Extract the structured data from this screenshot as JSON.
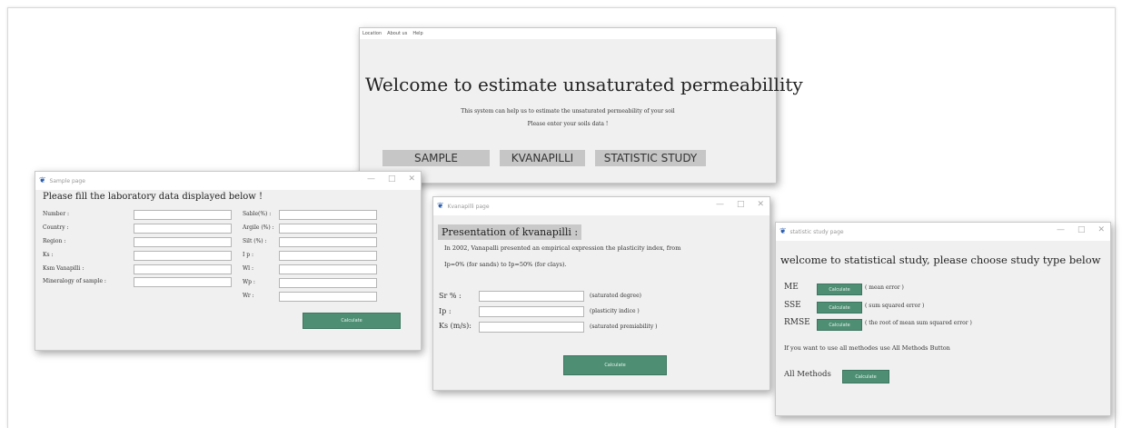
{
  "welcome": {
    "menu": [
      "Location",
      "About us",
      "Help"
    ],
    "title": "Welcome to estimate unsaturated permeabillity",
    "line1": "This system can help us to estimate the unsaturated permeability of your soil",
    "line2": "Please enter your soils data !",
    "buttons": [
      "SAMPLE",
      "KVANAPILLI",
      "STATISTIC STUDY"
    ]
  },
  "sample": {
    "window_title": "Sample page",
    "heading": "Please fill the laboratory data displayed below !",
    "left_labels": [
      "Number :",
      "Country :",
      "Region :",
      "Ks :",
      "Ksm Vanapilli :",
      "Mineralogy of sample :"
    ],
    "right_labels": [
      "Sable(%) :",
      "Argile (%) :",
      "Silt (%) :",
      "I p :",
      "Wl :",
      "Wp :",
      "Wr :"
    ],
    "button": "Calculate"
  },
  "kvanapilli": {
    "window_title": "Kvanapilli page",
    "heading": "Presentation of kvanapilli :",
    "text1": "In 2002, Vanapalli presented an empirical expression the plasticity index, from",
    "text2": "Ip=0% (for sands) to Ip=50% (for clays).",
    "fields": [
      {
        "label": "Sr % :",
        "hint": "(saturated degree)"
      },
      {
        "label": "Ip :",
        "hint": "(plasticity indice )"
      },
      {
        "label": "Ks (m/s):",
        "hint": "(saturated premiability )"
      }
    ],
    "button": "Calculate"
  },
  "statistic": {
    "window_title": "statistic study page",
    "heading": "welcome to statistical study, please choose study type below",
    "rows": [
      {
        "label": "ME",
        "button": "Calculate",
        "desc": "( mean error )"
      },
      {
        "label": "SSE",
        "button": "Calculate",
        "desc": "( sum squared error )"
      },
      {
        "label": "RMSE",
        "button": "Calculate",
        "desc": "( the root of mean sum squared error )"
      }
    ],
    "note": "If you want to use all methodes use All Methods Button",
    "all_label": "All Methods",
    "all_button": "Calculate"
  }
}
